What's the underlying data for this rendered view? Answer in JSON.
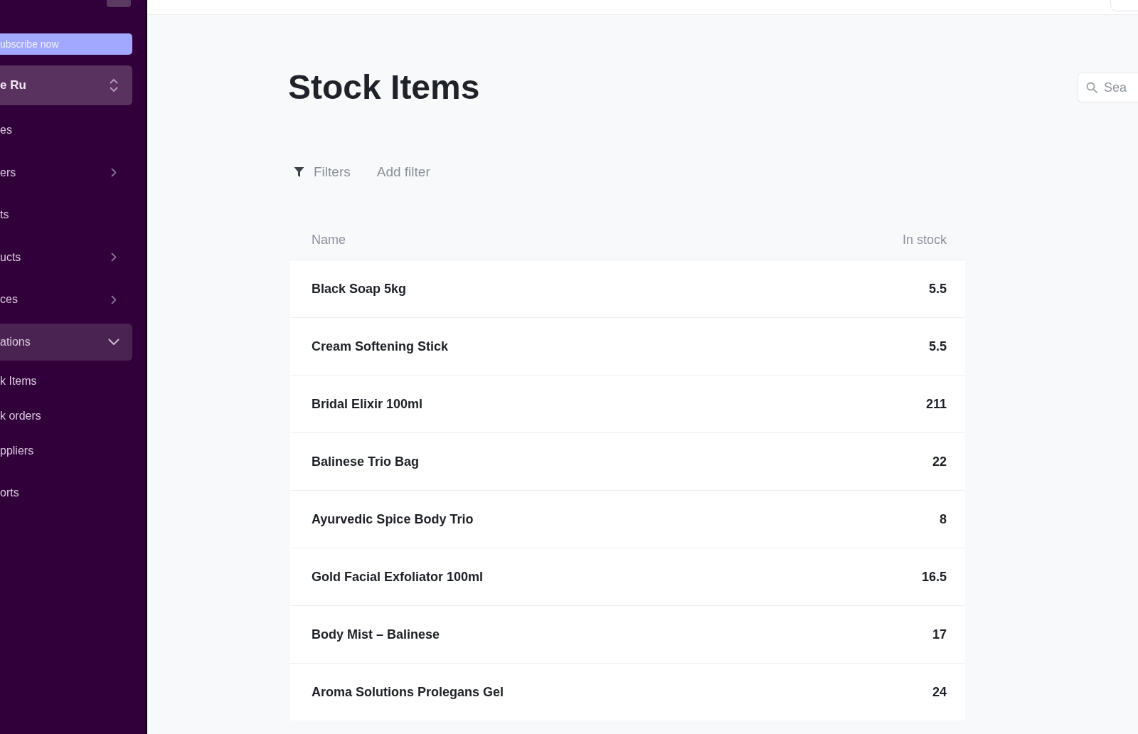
{
  "sidebar": {
    "banner": {
      "label": "ubscribe now"
    },
    "workspace": {
      "label": "e Ru"
    },
    "items": [
      {
        "kind": "link",
        "label": "es",
        "selected": false
      },
      {
        "kind": "group",
        "label": "ers",
        "selected": false,
        "expanded": false
      },
      {
        "kind": "link",
        "label": "ts",
        "selected": false
      },
      {
        "kind": "group",
        "label": "ucts",
        "selected": false,
        "expanded": false
      },
      {
        "kind": "group",
        "label": "ces",
        "selected": false,
        "expanded": false
      },
      {
        "kind": "group",
        "label": "ations",
        "selected": true,
        "expanded": true,
        "children": [
          {
            "label": "k Items",
            "selected": false
          },
          {
            "label": "k orders",
            "selected": false
          },
          {
            "label": "ppliers",
            "selected": false
          }
        ]
      },
      {
        "kind": "link",
        "label": "orts",
        "selected": false
      }
    ]
  },
  "page": {
    "title": "Stock Items",
    "search": {
      "placeholder": "Sea"
    }
  },
  "filters": {
    "label": "Filters",
    "add_label": "Add filter"
  },
  "table": {
    "columns": [
      "Name",
      "In stock"
    ],
    "rows": [
      {
        "name": "Black Soap 5kg",
        "in_stock": "5.5"
      },
      {
        "name": "Cream Softening Stick",
        "in_stock": "5.5"
      },
      {
        "name": "Bridal Elixir 100ml",
        "in_stock": "211"
      },
      {
        "name": "Balinese Trio Bag",
        "in_stock": "22"
      },
      {
        "name": "Ayurvedic Spice Body Trio",
        "in_stock": "8"
      },
      {
        "name": "Gold Facial Exfoliator 100ml",
        "in_stock": "16.5"
      },
      {
        "name": "Body Mist – Balinese",
        "in_stock": "17"
      },
      {
        "name": "Aroma Solutions Prolegans Gel",
        "in_stock": "24"
      }
    ]
  }
}
